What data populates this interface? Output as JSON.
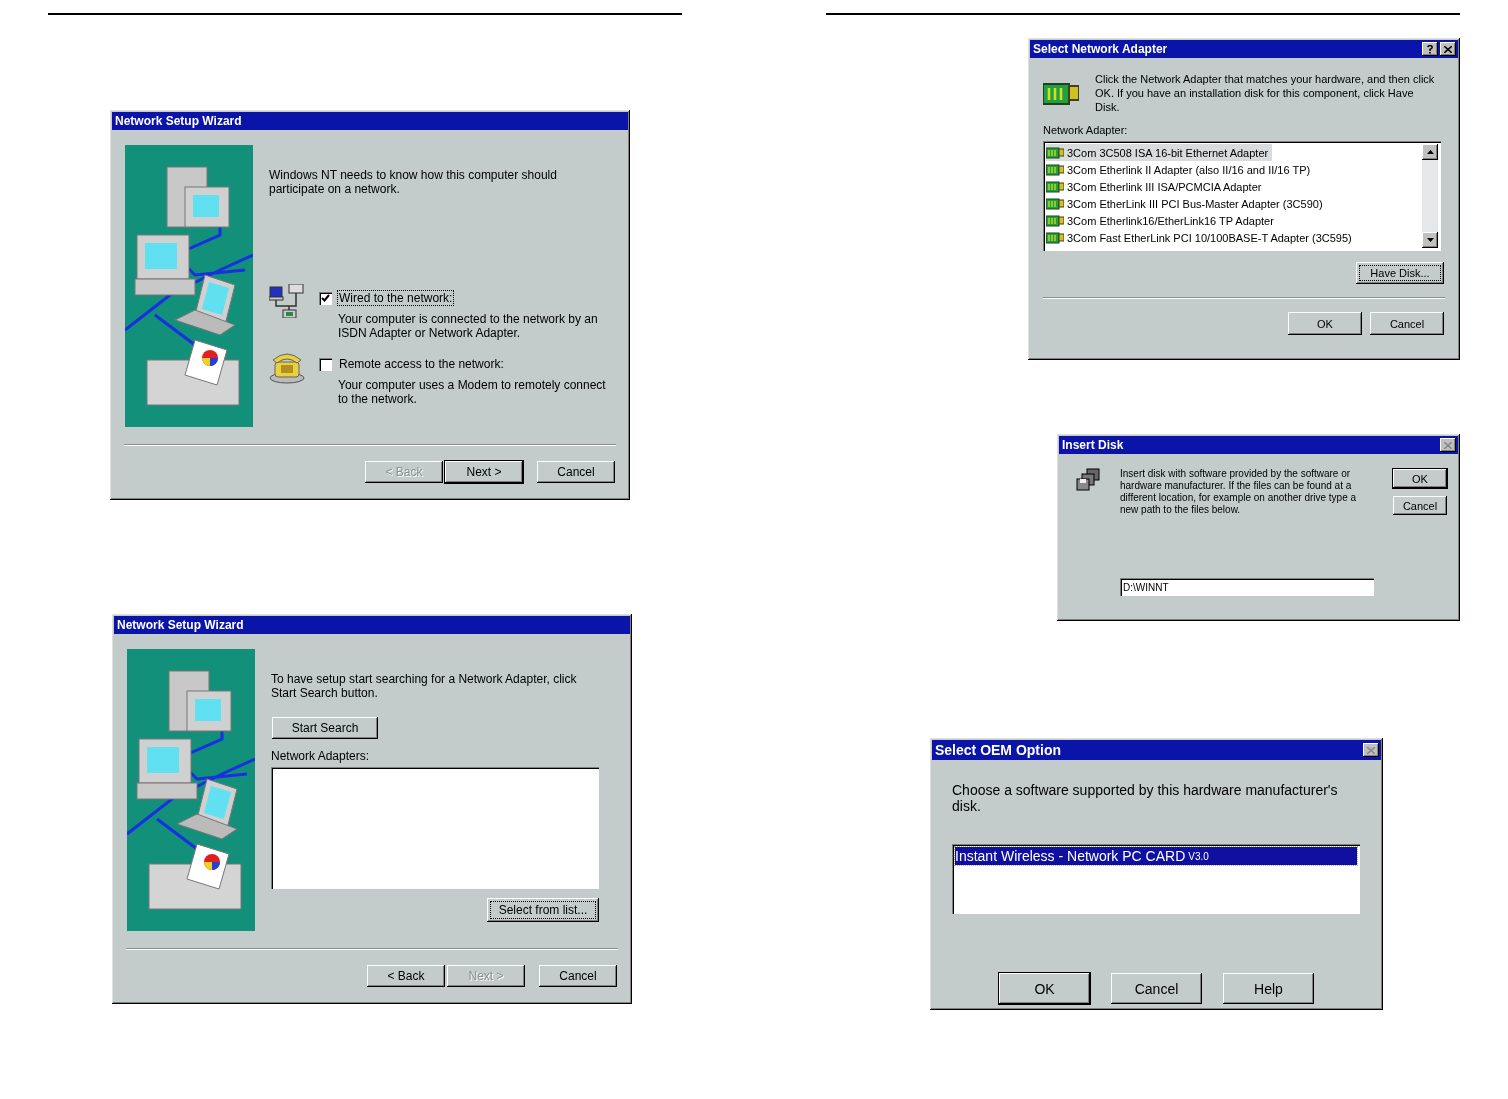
{
  "left_page": {
    "dialogs": [
      {
        "kind": "wizard_options",
        "title": "Network Setup Wizard",
        "intro": "Windows NT needs to know how this computer should participate on a network.",
        "options": [
          {
            "kind": "wired",
            "label": "Wired to the network:",
            "checked": true,
            "focused": true,
            "description": "Your computer is connected to the network by an ISDN Adapter or Network Adapter."
          },
          {
            "kind": "modem",
            "label": "Remote access to the network:",
            "checked": false,
            "focused": false,
            "description": "Your computer uses a Modem to remotely connect to the network."
          }
        ],
        "buttons": [
          {
            "label": "< Back",
            "disabled": true,
            "default": false
          },
          {
            "label": "Next >",
            "disabled": false,
            "default": true
          },
          {
            "label": "Cancel",
            "disabled": false,
            "default": false
          }
        ]
      },
      {
        "kind": "wizard_search",
        "title": "Network Setup Wizard",
        "intro": "To have setup start searching for a Network Adapter, click Start Search button.",
        "search_button": {
          "label": "Start Search",
          "focused": false
        },
        "list_label": "Network Adapters:",
        "list_button": {
          "label": "Select from list...",
          "focused": true
        },
        "buttons": [
          {
            "label": "< Back",
            "disabled": false,
            "default": false
          },
          {
            "label": "Next >",
            "disabled": true,
            "default": false
          },
          {
            "label": "Cancel",
            "disabled": false,
            "default": false
          }
        ]
      }
    ]
  },
  "right_page": {
    "dialogs": [
      {
        "kind": "adapter_list",
        "title": "Select Network Adapter",
        "help_button": true,
        "close_button": true,
        "intro": "Click the Network Adapter that matches your hardware, and then click OK.  If you have an installation disk for this component, click Have Disk.",
        "list_label": "Network Adapter:",
        "list": {
          "focused": false,
          "items": [
            {
              "label": "3Com 3C508 ISA 16-bit Ethernet Adapter",
              "selected": true
            },
            {
              "label": "3Com Etherlink II Adapter (also II/16 and II/16 TP)",
              "selected": false
            },
            {
              "label": "3Com Etherlink III ISA/PCMCIA Adapter",
              "selected": false
            },
            {
              "label": "3Com EtherLink III PCI Bus-Master Adapter (3C590)",
              "selected": false
            },
            {
              "label": "3Com Etherlink16/EtherLink16 TP Adapter",
              "selected": false
            },
            {
              "label": "3Com Fast EtherLink PCI 10/100BASE-T Adapter (3C595)",
              "selected": false
            }
          ]
        },
        "list_button": {
          "label": "Have Disk...",
          "focused": true
        },
        "buttons": [
          {
            "label": "OK",
            "disabled": false,
            "default": false
          },
          {
            "label": "Cancel",
            "disabled": false,
            "default": false
          }
        ]
      },
      {
        "kind": "insert_disk",
        "title": "Insert Disk",
        "close_button": true,
        "message": "Insert disk with software provided by the software or hardware manufacturer.  If the files can be found at a different location, for example on another drive type a new path to the files below.",
        "path": "D:\\WINNT",
        "buttons": [
          {
            "label": "OK",
            "disabled": false,
            "default": true
          },
          {
            "label": "Cancel",
            "disabled": false,
            "default": false
          }
        ]
      },
      {
        "kind": "oem_option",
        "title": "Select OEM Option",
        "close_button": true,
        "message": "Choose a software supported by this hardware manufacturer's disk.",
        "list": {
          "focused": true,
          "items": [
            {
              "label": "Instant Wireless - Network PC CARD",
              "version": "V3.0",
              "selected": true
            }
          ]
        },
        "buttons": [
          {
            "label": "OK",
            "disabled": false,
            "default": true
          },
          {
            "label": "Cancel",
            "disabled": false,
            "default": false
          },
          {
            "label": "Help",
            "disabled": false,
            "default": false
          }
        ]
      }
    ]
  }
}
